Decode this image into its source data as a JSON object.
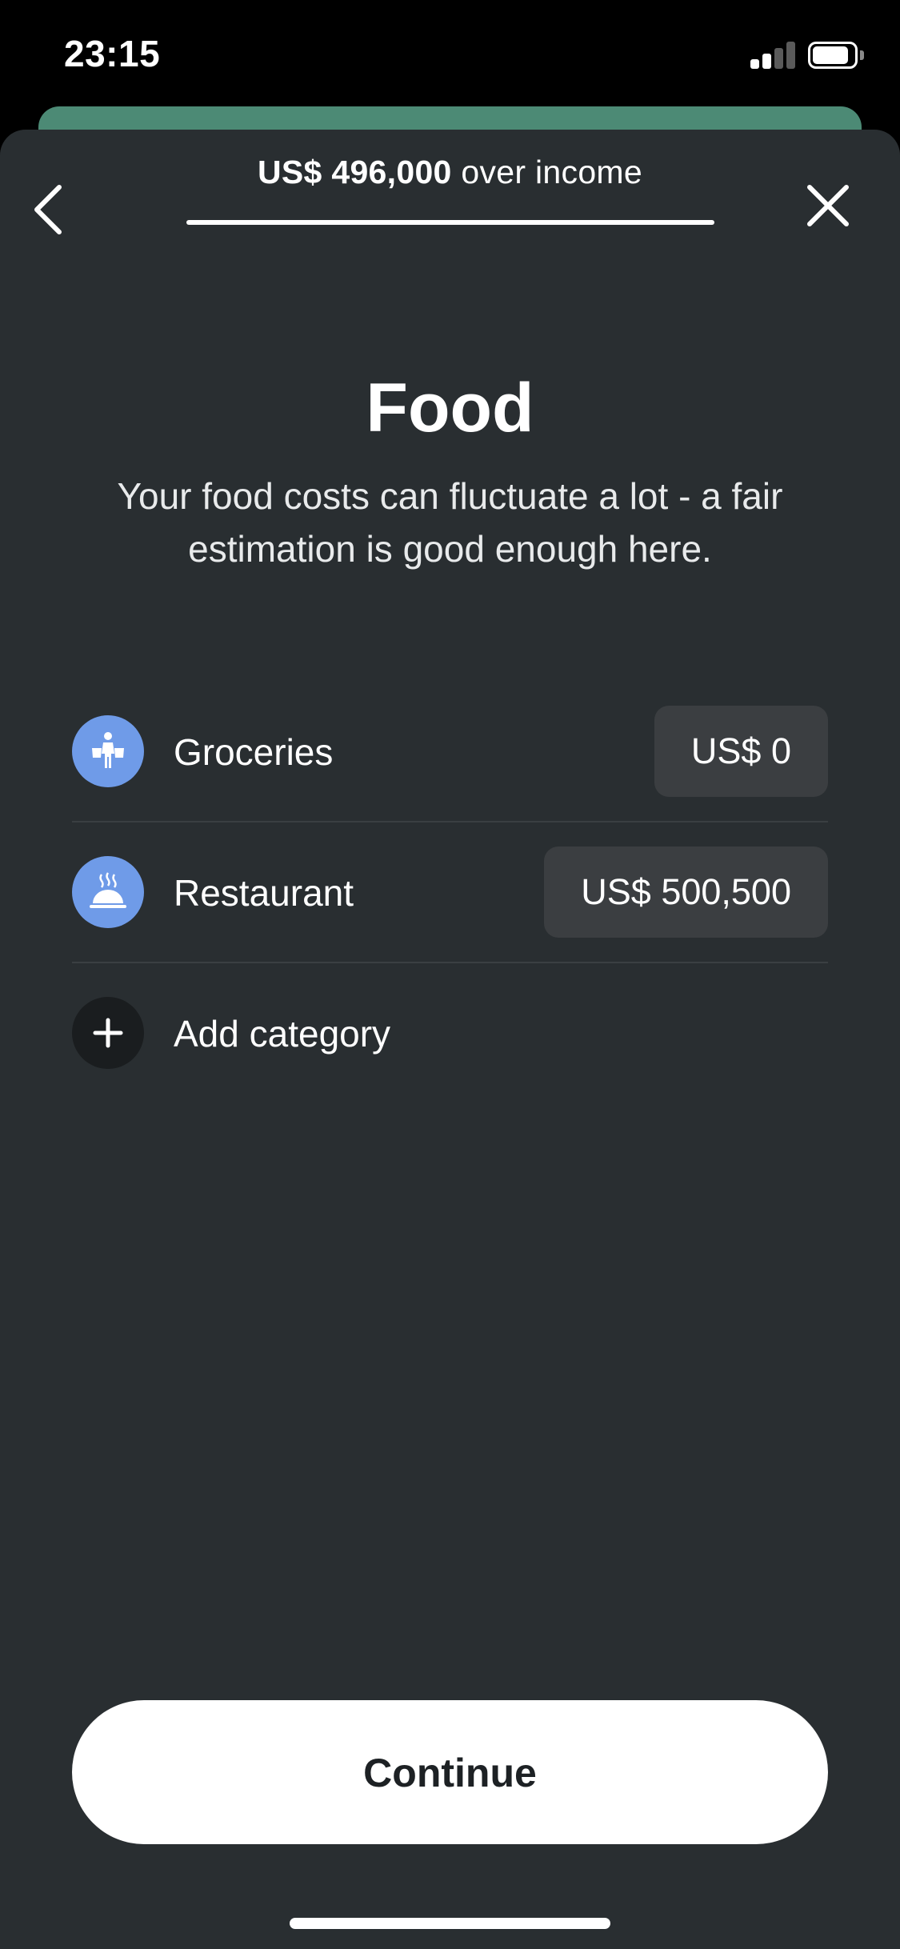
{
  "status_bar": {
    "time": "23:15",
    "signal_icon": "cellular-signal-icon",
    "battery_icon": "battery-icon"
  },
  "header": {
    "back_icon": "chevron-left-icon",
    "close_icon": "close-icon",
    "over_amount": "US$ 496,000",
    "over_text": "over income"
  },
  "page": {
    "title": "Food",
    "subtitle": "Your food costs can fluctuate a lot - a fair estimation is good enough here."
  },
  "categories": [
    {
      "label": "Groceries",
      "amount": "US$ 0",
      "icon": "grocery-bag-icon"
    },
    {
      "label": "Restaurant",
      "amount": "US$ 500,500",
      "icon": "serving-dish-icon"
    }
  ],
  "add_category": {
    "label": "Add category",
    "icon": "plus-icon"
  },
  "footer": {
    "continue_label": "Continue"
  },
  "colors": {
    "background": "#292e31",
    "accent_green": "#4c8a75",
    "category_icon_blue": "#6f9be8",
    "input_background": "#3b3e41"
  }
}
